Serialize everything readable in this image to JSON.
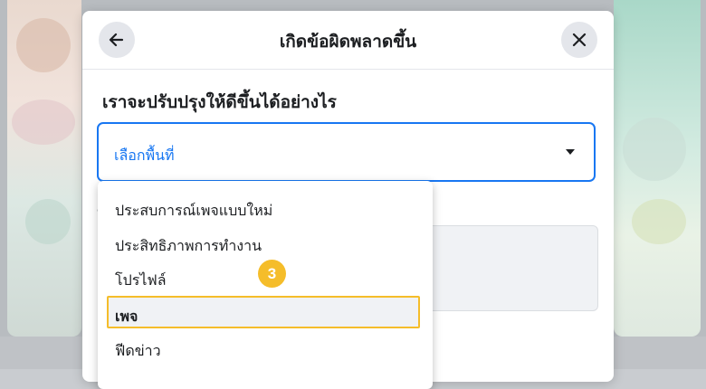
{
  "dialog": {
    "title": "เกิดข้อผิดพลาดขึ้น",
    "question": "เราจะปรับปรุงให้ดีขึ้นได้อย่างไร",
    "select_value": "เลือกพื้นที่"
  },
  "dropdown": {
    "options": [
      "ประสบการณ์เพจแบบใหม่",
      "ประสิทธิภาพการทำงาน",
      "โปรไฟล์",
      "เพจ",
      "ฟีดข่าว"
    ],
    "selected_index": 3
  },
  "annotation": {
    "step": "3"
  },
  "colors": {
    "accent": "#1877f2",
    "highlight": "#f5bd2a"
  }
}
